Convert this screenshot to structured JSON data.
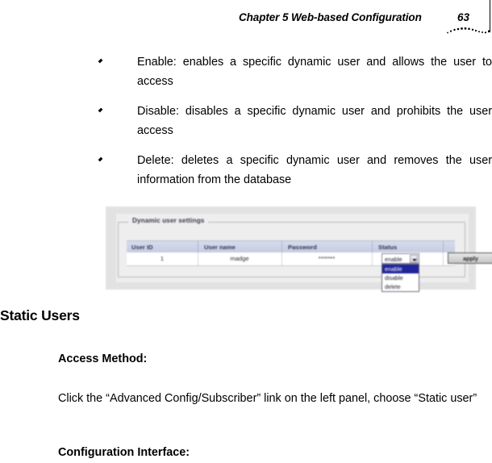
{
  "header": {
    "title": "Chapter 5 Web-based Configuration",
    "page_number": "63",
    "swash_icon": "dotted-arc-ornament"
  },
  "bullets": [
    {
      "marker_icon": "diamond-bullet-icon",
      "text": "Enable: enables a specific dynamic user and allows the user to access"
    },
    {
      "marker_icon": "diamond-bullet-icon",
      "text": "Disable: disables a specific dynamic user and prohibits the user access"
    },
    {
      "marker_icon": "diamond-bullet-icon",
      "text": "Delete: deletes a specific dynamic user and removes the user information from the database"
    }
  ],
  "screenshot": {
    "panel_legend": "Dynamic user settings",
    "table": {
      "columns": [
        "User ID",
        "User name",
        "Password",
        "Status"
      ],
      "rows": [
        {
          "user_id": "1",
          "user_name": "madge",
          "password": "*******",
          "status": "enable"
        }
      ]
    },
    "status_select": {
      "value": "enable",
      "arrow_icon": "chevron-down-icon",
      "options": [
        "enable",
        "disable",
        "delete"
      ],
      "highlighted_option": "enable",
      "highlight_color": "#21259b"
    },
    "apply_button_label": "apply"
  },
  "section": {
    "heading": "Static Users",
    "access_method_label": "Access Method:",
    "access_method_text": "Click the “Advanced Config/Subscriber” link on the left panel, choose “Static user”",
    "configuration_interface_label": "Configuration Interface:"
  }
}
